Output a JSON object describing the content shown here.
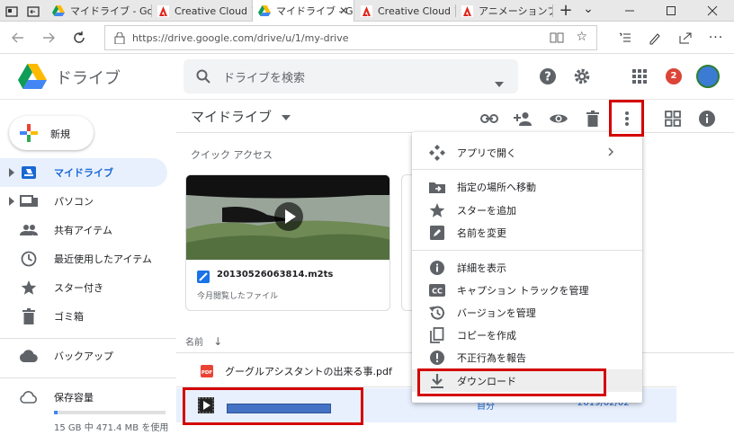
{
  "browser": {
    "tabs": [
      {
        "title": "マイドライブ - Goog",
        "icon": "drive-icon"
      },
      {
        "title": "Creative Cloud ア",
        "icon": "adobe-icon"
      },
      {
        "title": "マイドライブ - G",
        "icon": "drive-icon",
        "active": true
      },
      {
        "title": "Creative Cloud ア",
        "icon": "adobe-icon"
      },
      {
        "title": "アニメーションプリセ",
        "icon": "adobe-icon"
      }
    ],
    "new_tab": "+",
    "chevron": "⌄",
    "url": "https://drive.google.com/drive/u/1/my-drive"
  },
  "app": {
    "name": "ドライブ",
    "search_placeholder": "ドライブを検索",
    "notification_count": "2"
  },
  "sidebar": {
    "new_label": "新規",
    "items": [
      {
        "label": "マイドライブ",
        "icon": "my-drive-icon",
        "selected": true
      },
      {
        "label": "パソコン",
        "icon": "computer-icon"
      },
      {
        "label": "共有アイテム",
        "icon": "shared-icon"
      },
      {
        "label": "最近使用したアイテム",
        "icon": "clock-icon"
      },
      {
        "label": "スター付き",
        "icon": "star-icon"
      },
      {
        "label": "ゴミ箱",
        "icon": "trash-icon"
      },
      {
        "label": "バックアップ",
        "icon": "cloud-icon"
      }
    ],
    "storage_label": "保存容量",
    "storage_text": "15 GB 中 471.4 MB を使用",
    "storage_fraction": 0.031
  },
  "main": {
    "title": "マイドライブ",
    "quick_access_label": "クイック アクセス",
    "quick_card": {
      "filename": "20130526063814.m2ts",
      "subtitle": "今月閲覧したファイル"
    },
    "column_name": "名前",
    "files": [
      {
        "name": "グーグルアシスタントの出来る事.pdf",
        "owner": "",
        "date": "",
        "type": "pdf"
      },
      {
        "name": "",
        "owner": "自分",
        "date": "2019/02/02",
        "type": "video",
        "selected": true
      }
    ]
  },
  "context_menu": {
    "items": [
      {
        "label": "アプリで開く",
        "icon": "apps-open-icon",
        "submenu": true
      },
      {
        "label": "指定の場所へ移動",
        "icon": "move-folder-icon"
      },
      {
        "label": "スターを追加",
        "icon": "star-icon"
      },
      {
        "label": "名前を変更",
        "icon": "rename-icon"
      },
      {
        "label": "詳細を表示",
        "icon": "info-icon"
      },
      {
        "label": "キャプション トラックを管理",
        "icon": "cc-icon"
      },
      {
        "label": "バージョンを管理",
        "icon": "history-icon"
      },
      {
        "label": "コピーを作成",
        "icon": "copy-icon"
      },
      {
        "label": "不正行為を報告",
        "icon": "report-icon"
      },
      {
        "label": "ダウンロード",
        "icon": "download-icon",
        "highlighted": true
      }
    ]
  }
}
